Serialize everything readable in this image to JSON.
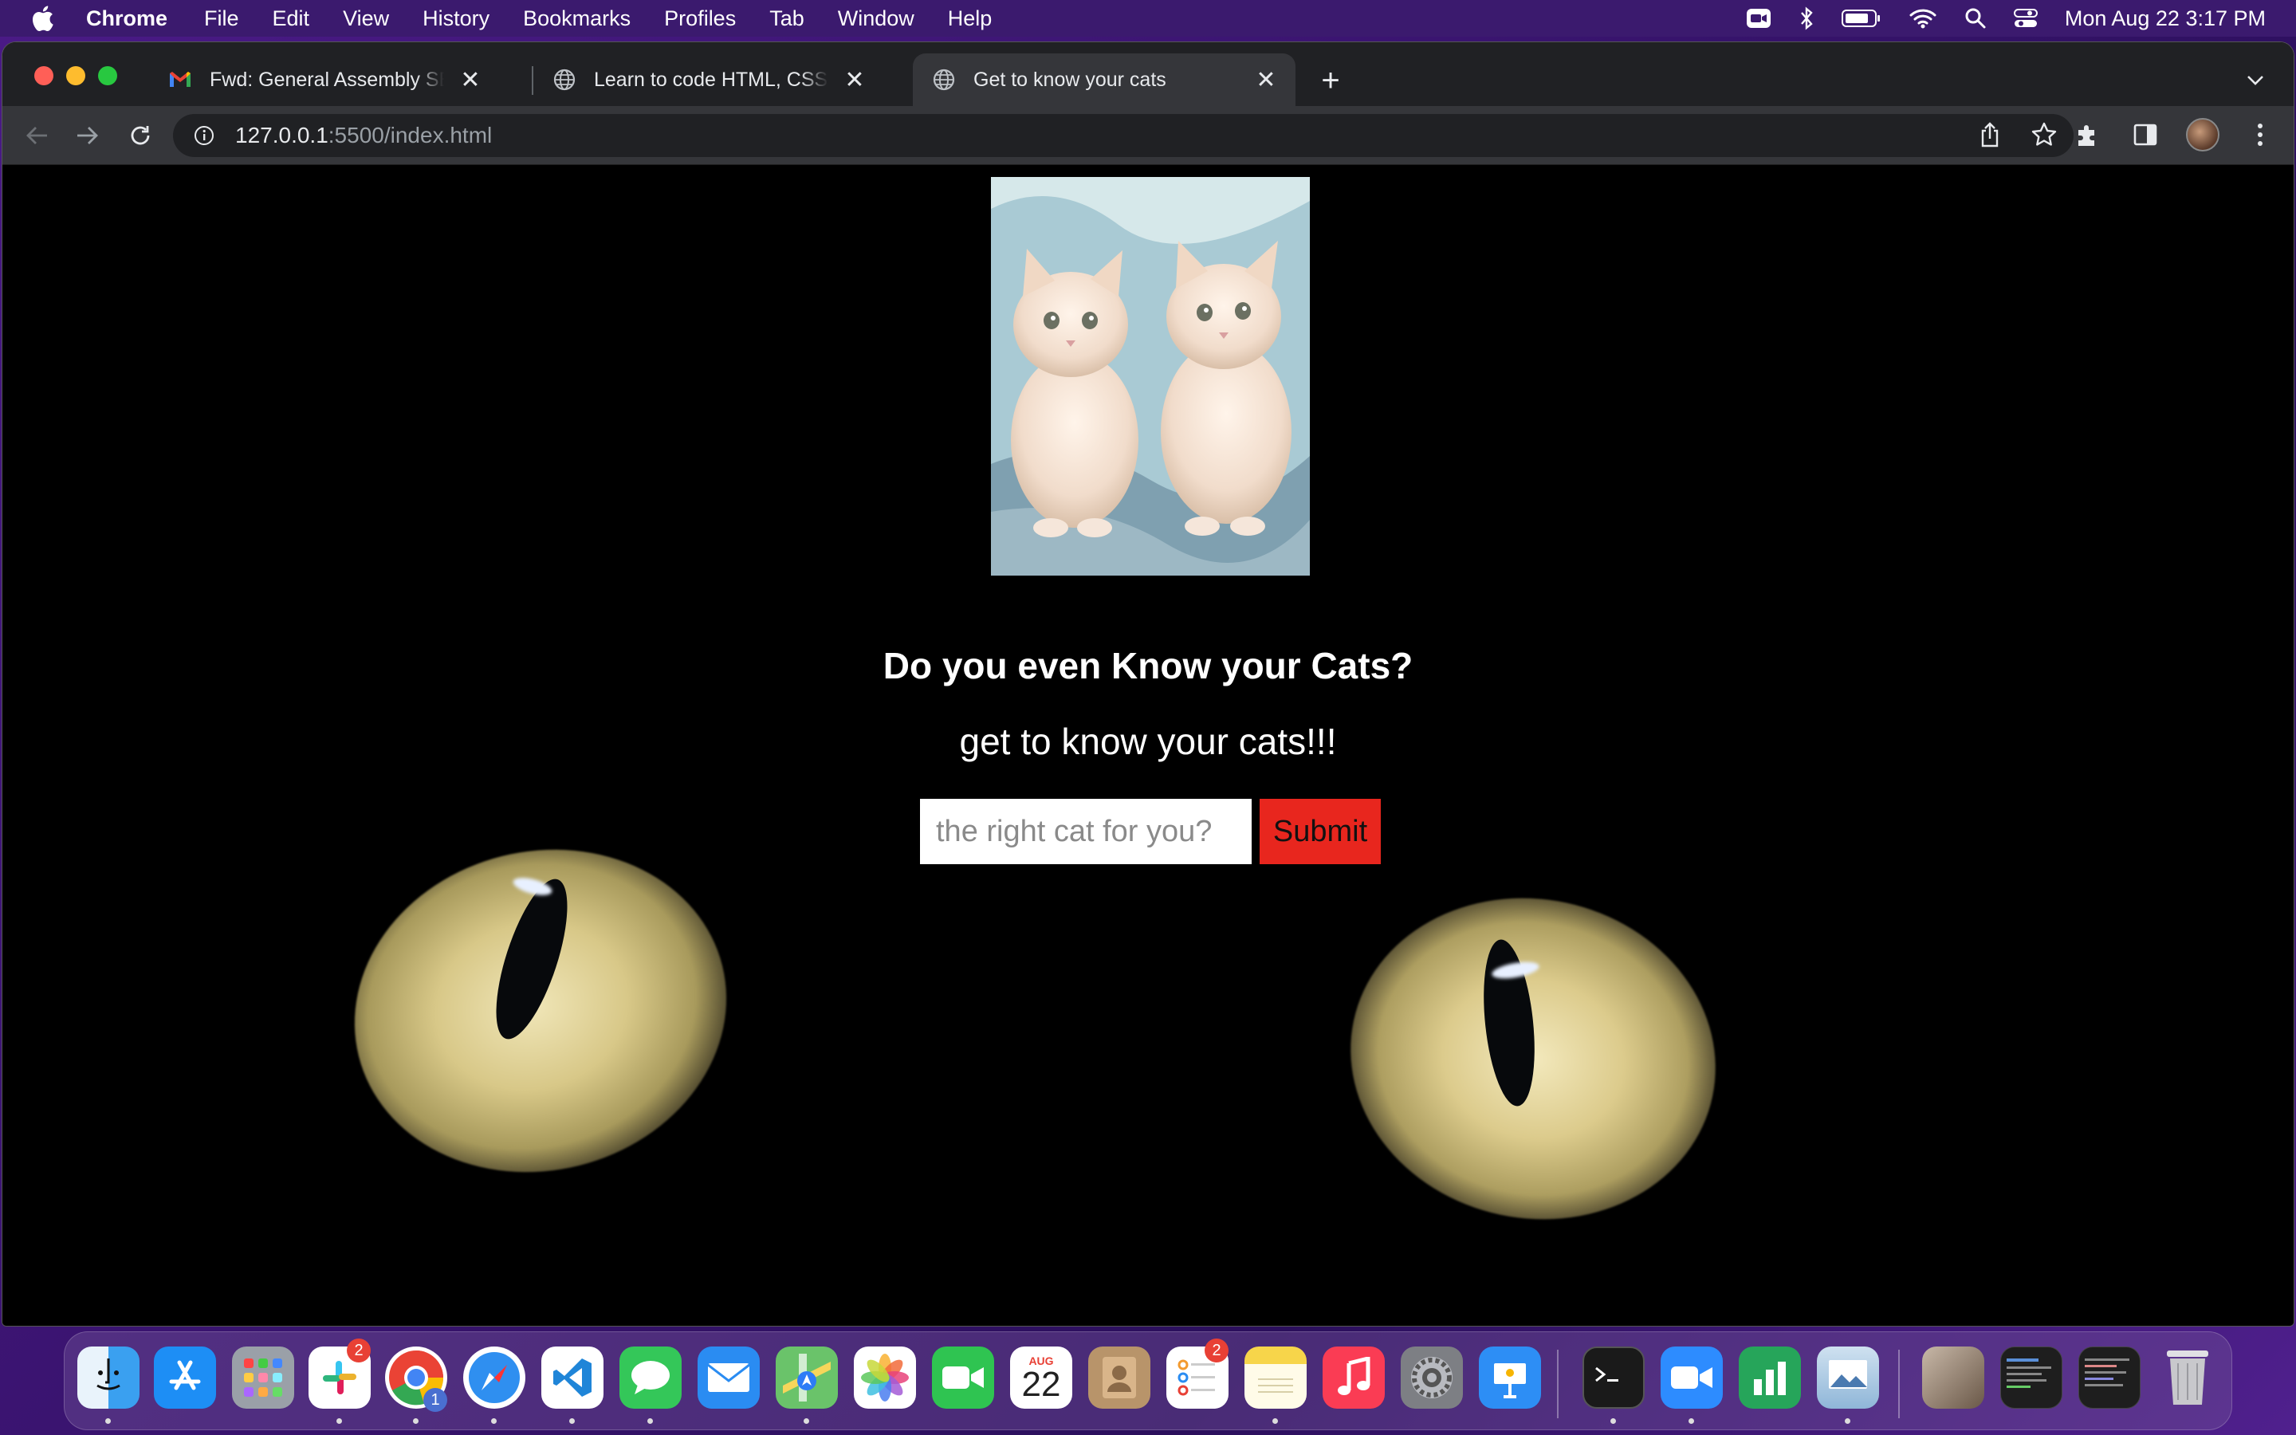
{
  "menubar": {
    "app_name": "Chrome",
    "items": [
      "File",
      "Edit",
      "View",
      "History",
      "Bookmarks",
      "Profiles",
      "Tab",
      "Window",
      "Help"
    ],
    "clock": "Mon Aug 22  3:17 PM"
  },
  "tabs": [
    {
      "title": "Fwd: General Assembly SEI Interview",
      "favicon": "gmail-icon",
      "active": false
    },
    {
      "title": "Learn to code HTML, CSS, and JavaScript",
      "favicon": "globe-icon",
      "active": false
    },
    {
      "title": "Get to know your cats",
      "favicon": "globe-icon",
      "active": true
    }
  ],
  "address": {
    "host": "127.0.0.1",
    "path": ":5500/index.html"
  },
  "page": {
    "kitten_image_alt": "two cream kittens",
    "headline": "Do you even Know your Cats?",
    "subline": "get to know your cats!!!",
    "input_placeholder": "the right cat for you?",
    "input_value": "",
    "submit_label": "Submit"
  },
  "dock": {
    "apps": [
      {
        "name": "Finder",
        "icon": "finder-icon",
        "color": "#3aa0f0",
        "running": true
      },
      {
        "name": "App Store",
        "icon": "app-store-icon",
        "color": "#1d8ef5",
        "running": false
      },
      {
        "name": "Launchpad",
        "icon": "launchpad-icon",
        "color": "#9aa0a8",
        "running": false
      },
      {
        "name": "Slack",
        "icon": "slack-icon",
        "color": "#ffffff",
        "running": true,
        "badge": "2"
      },
      {
        "name": "Chrome",
        "icon": "chrome-icon",
        "color": "#ffffff",
        "running": true,
        "badge": "1"
      },
      {
        "name": "Safari",
        "icon": "safari-icon",
        "color": "#2f8ff0",
        "running": true
      },
      {
        "name": "Visual Studio Code",
        "icon": "vscode-icon",
        "color": "#ffffff",
        "running": true
      },
      {
        "name": "Messages",
        "icon": "messages-icon",
        "color": "#34c759",
        "running": true
      },
      {
        "name": "Mail",
        "icon": "mail-icon",
        "color": "#2a8cf2",
        "running": false
      },
      {
        "name": "Maps",
        "icon": "maps-icon",
        "color": "#6ac36a",
        "running": true
      },
      {
        "name": "Photos",
        "icon": "photos-icon",
        "color": "#ffffff",
        "running": false
      },
      {
        "name": "FaceTime",
        "icon": "facetime-icon",
        "color": "#2fc451",
        "running": false
      },
      {
        "name": "Calendar",
        "icon": "calendar-icon",
        "color": "#ffffff",
        "running": false,
        "month": "AUG",
        "day": "22"
      },
      {
        "name": "Contacts",
        "icon": "contacts-icon",
        "color": "#b8946a",
        "running": false
      },
      {
        "name": "Reminders",
        "icon": "reminders-icon",
        "color": "#ffffff",
        "running": false,
        "badge": "2"
      },
      {
        "name": "Notes",
        "icon": "notes-icon",
        "color": "#f7d54a",
        "running": true
      },
      {
        "name": "Music",
        "icon": "music-icon",
        "color": "#fa3c54",
        "running": false
      },
      {
        "name": "System Preferences",
        "icon": "system-preferences-icon",
        "color": "#7d7f84",
        "running": false
      },
      {
        "name": "Keynote",
        "icon": "keynote-icon",
        "color": "#2d8ef5",
        "running": false
      },
      {
        "name": "Terminal",
        "icon": "terminal-icon",
        "color": "#1a1a1a",
        "running": true
      },
      {
        "name": "Zoom",
        "icon": "zoom-icon",
        "color": "#2d8cff",
        "running": true
      },
      {
        "name": "Numbers",
        "icon": "numbers-icon",
        "color": "#26a55a",
        "running": false
      },
      {
        "name": "Preview",
        "icon": "preview-icon",
        "color": "#8fb6d8",
        "running": true
      }
    ]
  },
  "colors": {
    "submit_bg": "#e8261e",
    "tab_active": "#35363a",
    "tabstrip": "#202124"
  }
}
